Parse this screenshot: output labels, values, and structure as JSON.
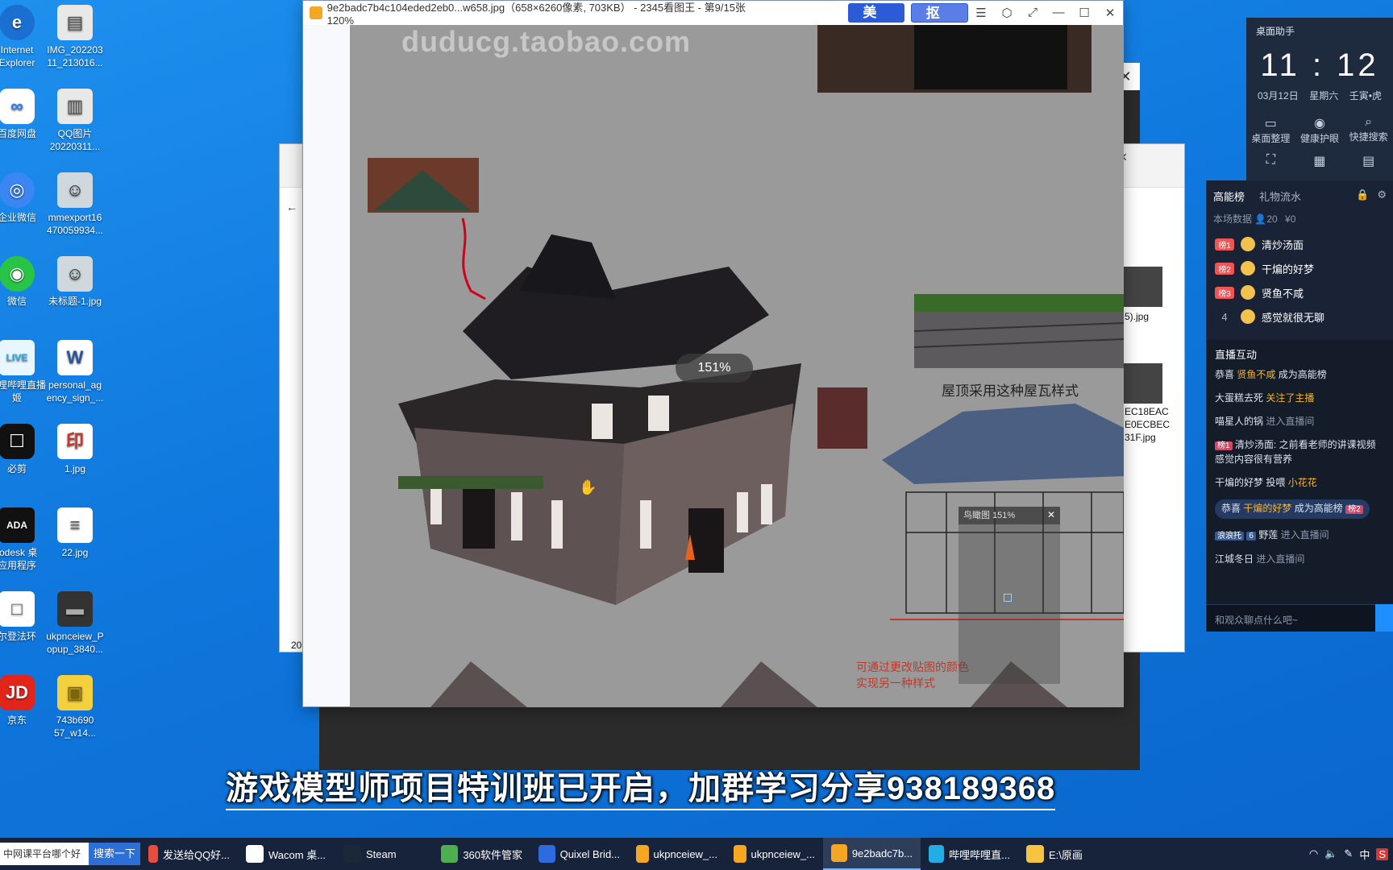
{
  "desktop": {
    "icons": [
      {
        "label": "Internet\nExplorer",
        "glyph": "e"
      },
      {
        "label": "IMG_202203\n11_213016...",
        "glyph": "▤"
      },
      {
        "label": "百度网盘",
        "glyph": "∞"
      },
      {
        "label": "QQ图片\n20220311...",
        "glyph": "▥"
      },
      {
        "label": "企业微信",
        "glyph": "◎"
      },
      {
        "label": "mmexport16\n470059934...",
        "glyph": "☺"
      },
      {
        "label": "微信",
        "glyph": "◉"
      },
      {
        "label": "未标题-1.jpg",
        "glyph": "☺"
      },
      {
        "label": "哔哩哔哩直播\n姬",
        "glyph": "LIVE"
      },
      {
        "label": "personal_ag\nency_sign_...",
        "glyph": "W"
      },
      {
        "label": "必剪",
        "glyph": "☐"
      },
      {
        "label": "1.jpg",
        "glyph": "印"
      },
      {
        "label": "todesk 桌\n应用程序",
        "glyph": "ADA"
      },
      {
        "label": "22.jpg",
        "glyph": "≡"
      },
      {
        "label": "尔登法环",
        "glyph": "□"
      },
      {
        "label": "ukpnceiew_P\nopup_3840...",
        "glyph": "▬"
      },
      {
        "label": "京东",
        "glyph": "JD"
      },
      {
        "label": "743b690\n57_w14...",
        "glyph": "▣"
      }
    ]
  },
  "background_window": {
    "file_1": "5).jpg",
    "file_2": "EC18EAC\nE0ECBEC\n31F.jpg",
    "status_left": "20"
  },
  "viewer": {
    "title": "9e2badc7b4c104eded2eb0...w658.jpg（658×6260像素, 703KB） - 2345看图王 - 第9/15张 120%",
    "btn_meitu": "美图",
    "btn_koutu": "抠图",
    "win_icons": [
      "☰",
      "⬡",
      "⤢",
      "—",
      "☐",
      "✕"
    ],
    "watermark": "duducg.taobao.com",
    "zoom_pill": "151%",
    "roof_caption": "屋顶采用这种屋瓦样式",
    "red_caption_1": "可通过更改贴图的颜色",
    "red_caption_2": "实现另一种样式",
    "bird_view_label": "鸟瞰图 151%",
    "bird_view_close": "✕"
  },
  "side_panel": {
    "header": "桌面助手",
    "clock": "11 : 12",
    "date": "03月12日",
    "weekday": "星期六",
    "lunar": "壬寅•虎",
    "tools": [
      {
        "icon": "▭",
        "label": "桌面整理"
      },
      {
        "icon": "◉",
        "label": "健康护眼"
      },
      {
        "icon": "⌕",
        "label": "快捷搜索"
      }
    ],
    "tool_icons_row2": [
      "⛶",
      "▦",
      "▤"
    ]
  },
  "rank": {
    "tab_active": "高能榜",
    "tab_other": "礼物流水",
    "stats_label": "本场数据",
    "stats_people": "20",
    "stats_money": "¥0",
    "items": [
      {
        "badge": "榜1",
        "name": "清炒汤面"
      },
      {
        "badge": "榜2",
        "name": "干煸的好梦"
      },
      {
        "badge": "榜3",
        "name": "贤鱼不咸"
      },
      {
        "badge": "4",
        "name": "感觉就很无聊"
      }
    ]
  },
  "chat": {
    "title": "直播互动",
    "msgs": {
      "m0_pre": "恭喜",
      "m0_name": "贤鱼不咸",
      "m0_post": "成为高能榜",
      "m1_name": "大蛋糕去死",
      "m1_act": "关注了主播",
      "m2_name": "喵星人的锅",
      "m2_act": "进入直播间",
      "m3_tag": "榜1",
      "m3_text": "清炒汤面: 之前看老师的讲课视频感觉内容很有营养",
      "m4_name": "干煸的好梦",
      "m4_act": "投喂",
      "m4_gift": "小花花",
      "m5_pre": "恭喜",
      "m5_name": "干煸的好梦",
      "m5_post": "成为高能榜",
      "m5_tag": "榜2",
      "m6_tag": "浪浪托",
      "m6_level": "6",
      "m6_name": "野莲",
      "m6_act": "进入直播间",
      "m7_name": "江城冬日",
      "m7_act": "进入直播间"
    },
    "input_placeholder": "和观众聊点什么吧~"
  },
  "subtitle": "游戏模型师项目特训班已开启，加群学习分享938189368",
  "taskbar": {
    "search_text": "中网课平台哪个好",
    "search_btn": "搜索一下",
    "items": [
      {
        "label": "发送给QQ好...",
        "color": "#e74c3c"
      },
      {
        "label": "Wacom 桌...",
        "color": "#ffffff"
      },
      {
        "label": "Steam",
        "color": "#1b2838"
      },
      {
        "label": "360软件管家",
        "color": "#4caf50"
      },
      {
        "label": "Quixel Brid...",
        "color": "#2d6cdf"
      },
      {
        "label": "ukpnceiew_...",
        "color": "#f5a623"
      },
      {
        "label": "ukpnceiew_...",
        "color": "#f5a623"
      },
      {
        "label": "9e2badc7b...",
        "color": "#f5a623"
      },
      {
        "label": "哔哩哔哩直...",
        "color": "#23ade5"
      },
      {
        "label": "E:\\原画",
        "color": "#f5c542"
      }
    ],
    "tray_lang": "中",
    "tray_ime": "S"
  }
}
